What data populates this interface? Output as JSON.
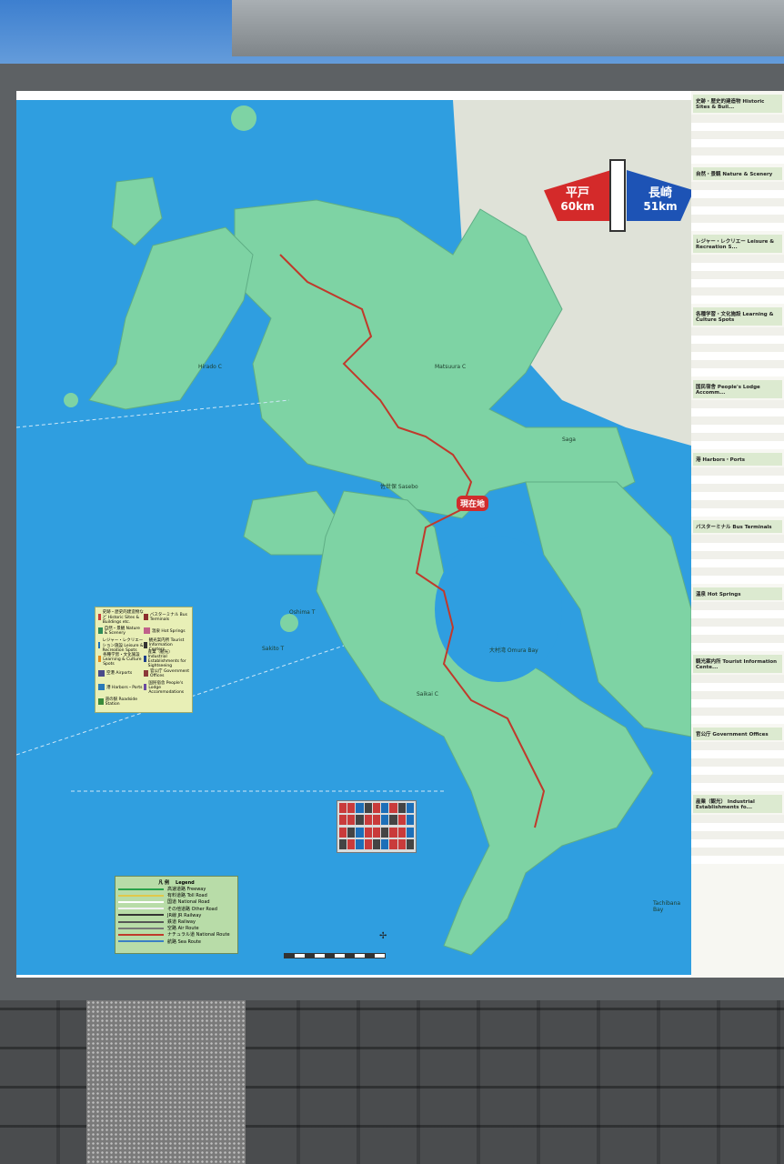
{
  "sign": {
    "left_name": "平戸",
    "left_distance": "60km",
    "right_name": "長崎",
    "right_distance": "51km",
    "left_color": "#d42a2a",
    "right_color": "#1d53b5"
  },
  "current_location": "現在地",
  "legend_lines": {
    "title_jp": "凡 例",
    "title_en": "Legend",
    "items": [
      {
        "jp": "高速道路",
        "en": "Freeway",
        "color": "#2aa14a"
      },
      {
        "jp": "有料道路",
        "en": "Toll Road",
        "color": "#e0c84a"
      },
      {
        "jp": "国道",
        "en": "National Road",
        "color": "#ffffff"
      },
      {
        "jp": "その他道路",
        "en": "Other Road",
        "color": "#f2f2f2"
      },
      {
        "jp": "JR線",
        "en": "JR Railway",
        "color": "#333333"
      },
      {
        "jp": "鉄道",
        "en": "Railway",
        "color": "#555555"
      },
      {
        "jp": "空路",
        "en": "Air Route",
        "color": "#777777"
      },
      {
        "jp": "ナチュラル道",
        "en": "National Route",
        "color": "#c0392b"
      },
      {
        "jp": "航路",
        "en": "Sea Route",
        "color": "#3b7fc4"
      }
    ]
  },
  "legend_icons": {
    "items": [
      {
        "jp": "史跡・歴史的建造物など",
        "en": "Historic Sites & Buildings etc.",
        "color": "#c93b3b"
      },
      {
        "jp": "バスターミナル",
        "en": "Bus Terminals",
        "color": "#8b2e2e"
      },
      {
        "jp": "自然・景観",
        "en": "Nature & Scenery",
        "color": "#2e8b57"
      },
      {
        "jp": "温泉",
        "en": "Hot Springs",
        "color": "#c0608a"
      },
      {
        "jp": "レジャー・レクリエーション施設",
        "en": "Leisure & Recreation Spots",
        "color": "#1d6fb8"
      },
      {
        "jp": "観光案内所",
        "en": "Tourist Information Centers",
        "color": "#333333"
      },
      {
        "jp": "各種学習・文化施設",
        "en": "Learning & Culture Spots",
        "color": "#e08a1e"
      },
      {
        "jp": "産業（観光）",
        "en": "Industrial Establishments for Sightseeing",
        "color": "#1d3f8b"
      },
      {
        "jp": "空港",
        "en": "Airports",
        "color": "#4a4a8a"
      },
      {
        "jp": "官公庁",
        "en": "Government Offices",
        "color": "#8b3a3a"
      },
      {
        "jp": "港",
        "en": "Harbors・Ports",
        "color": "#2a7ab8"
      },
      {
        "jp": "国民宿舎",
        "en": "People's Lodge Accommodations",
        "color": "#6a4aa0"
      },
      {
        "jp": "道の駅",
        "en": "Roadside Station",
        "color": "#3a8a3a"
      }
    ]
  },
  "side_panel": {
    "sections": [
      {
        "jp": "史跡・歴史的建造物",
        "en": "Historic Sites & Buil..."
      },
      {
        "jp": "自然・景観",
        "en": "Nature & Scenery"
      },
      {
        "jp": "レジャー・レクリエー",
        "en": "Leisure & Recreation S..."
      },
      {
        "jp": "各種学習・文化施設",
        "en": "Learning & Culture Spots"
      },
      {
        "jp": "国民宿舎",
        "en": "People's Lodge Accomm..."
      },
      {
        "jp": "港",
        "en": "Harbors・Ports"
      },
      {
        "jp": "バスターミナル",
        "en": "Bus Terminals"
      },
      {
        "jp": "温泉",
        "en": "Hot Springs"
      },
      {
        "jp": "観光案内所",
        "en": "Tourist Information Cente..."
      },
      {
        "jp": "官公庁",
        "en": "Government Offices"
      },
      {
        "jp": "産業（観光）",
        "en": "Industrial Establishments fo..."
      }
    ]
  },
  "place_labels": [
    {
      "text": "佐世保",
      "en": "Sasebo"
    },
    {
      "text": "大村湾",
      "en": "Omura Bay"
    },
    {
      "text": "Sakito T"
    },
    {
      "text": "Oshima T"
    },
    {
      "text": "Saikai C"
    },
    {
      "text": "Matsuura C"
    },
    {
      "text": "Hirado C"
    },
    {
      "text": "Saga"
    },
    {
      "text": "Tachibana Bay"
    }
  ],
  "colors": {
    "sea": "#2f9ee0",
    "land": "#7ed3a4",
    "route": "#c0392b"
  }
}
